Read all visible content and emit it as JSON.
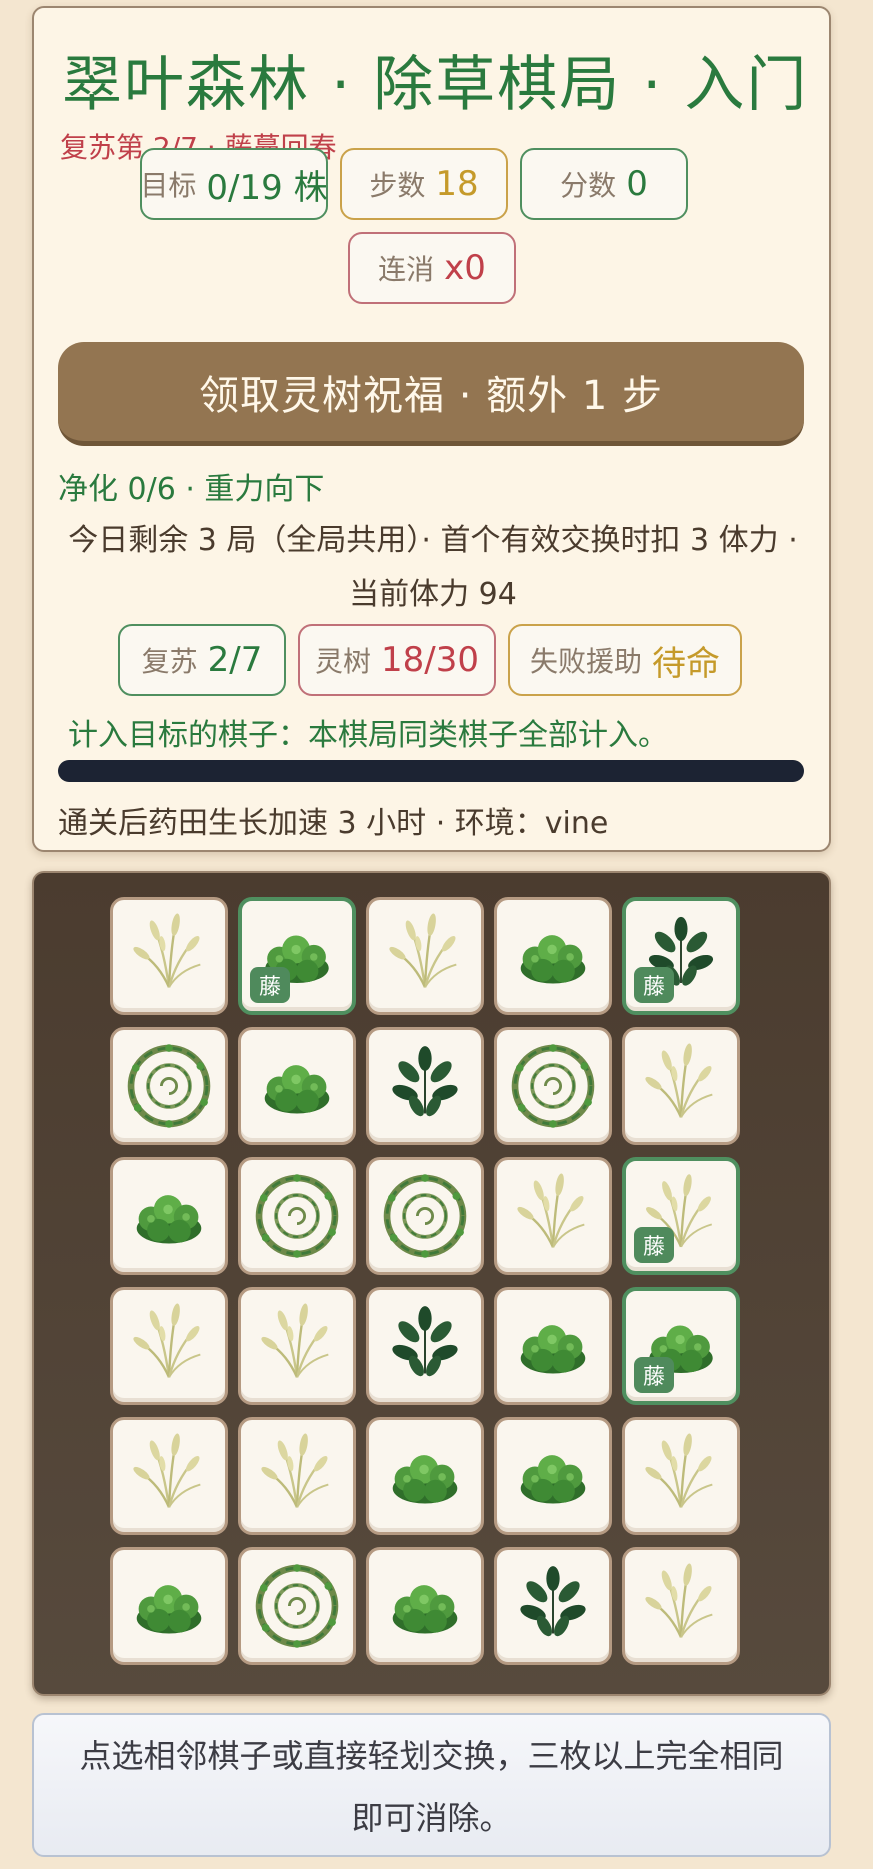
{
  "header": {
    "title": "翠叶森林 · 除草棋局 · 入门",
    "revive_line": "复苏第 2/7 · 藤蔓回春"
  },
  "stats": {
    "target_label": "目标",
    "target_value": "0/19 株",
    "steps_label": "步数",
    "steps_value": "18",
    "score_label": "分数",
    "score_value": "0",
    "combo_label": "连消",
    "combo_value": "x0"
  },
  "blessing_button": "领取灵树祝福 · 额外 1 步",
  "purify_line": "净化 0/6 · 重力向下",
  "notice": "今日剩余 3 局（全局共用）· 首个有效交换时扣 3 体力 · 当前体力 94",
  "status": {
    "revive_label": "复苏",
    "revive_value": "2/7",
    "tree_label": "灵树",
    "tree_value": "18/30",
    "assist_label": "失败援助",
    "assist_value": "待命"
  },
  "target_hint": "计入目标的棋子：本棋局同类棋子全部计入。",
  "progress": 0,
  "reward_line": "通关后药田生长加速 3 小时 · 环境：vine",
  "board": {
    "vine_badge": "藤",
    "rows": [
      [
        {
          "piece": "grass"
        },
        {
          "piece": "clover",
          "vine": true
        },
        {
          "piece": "grass"
        },
        {
          "piece": "clover"
        },
        {
          "piece": "leaf",
          "vine": true
        }
      ],
      [
        {
          "piece": "wreath"
        },
        {
          "piece": "clover"
        },
        {
          "piece": "leaf"
        },
        {
          "piece": "wreath"
        },
        {
          "piece": "grass"
        }
      ],
      [
        {
          "piece": "clover"
        },
        {
          "piece": "wreath"
        },
        {
          "piece": "wreath"
        },
        {
          "piece": "grass"
        },
        {
          "piece": "grass",
          "vine": true
        }
      ],
      [
        {
          "piece": "grass"
        },
        {
          "piece": "grass"
        },
        {
          "piece": "leaf"
        },
        {
          "piece": "clover"
        },
        {
          "piece": "clover",
          "vine": true
        }
      ],
      [
        {
          "piece": "grass"
        },
        {
          "piece": "grass"
        },
        {
          "piece": "clover"
        },
        {
          "piece": "clover"
        },
        {
          "piece": "grass"
        }
      ],
      [
        {
          "piece": "clover"
        },
        {
          "piece": "wreath"
        },
        {
          "piece": "clover"
        },
        {
          "piece": "leaf"
        },
        {
          "piece": "grass"
        }
      ]
    ]
  },
  "footer_hint": "点选相邻棋子或直接轻划交换，三枚以上完全相同即可消除。"
}
